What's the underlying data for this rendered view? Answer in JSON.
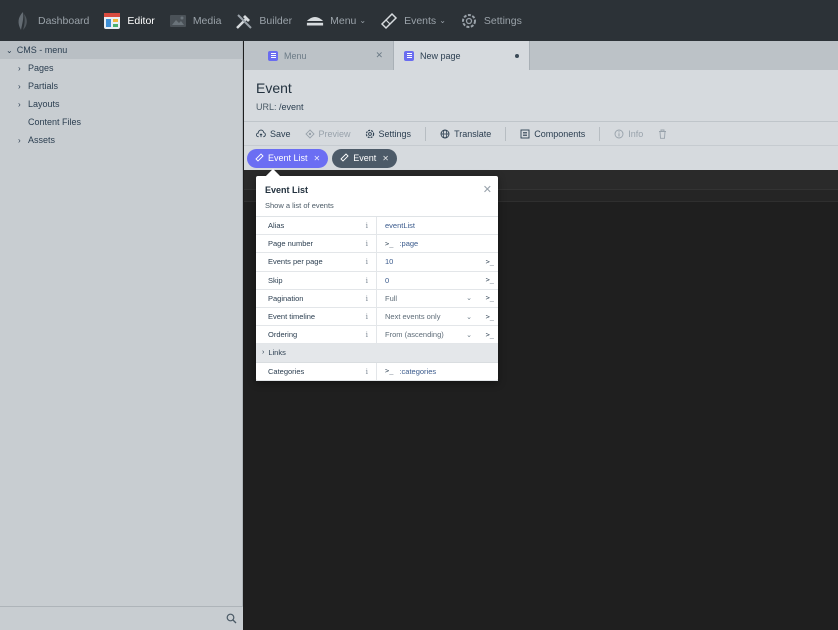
{
  "nav": {
    "items": [
      {
        "label": "Dashboard",
        "icon": "october-logo-icon",
        "active": false
      },
      {
        "label": "Editor",
        "icon": "editor-icon",
        "active": true
      },
      {
        "label": "Media",
        "icon": "media-icon",
        "active": false
      },
      {
        "label": "Builder",
        "icon": "builder-icon",
        "active": false
      },
      {
        "label": "Menu",
        "icon": "menu-icon",
        "active": false
      },
      {
        "label": "Events",
        "icon": "events-icon",
        "active": false
      },
      {
        "label": "Settings",
        "icon": "gear-icon",
        "active": false
      }
    ]
  },
  "sidebar": {
    "root": "CMS - menu",
    "items": [
      {
        "label": "Pages",
        "expandable": true
      },
      {
        "label": "Partials",
        "expandable": true
      },
      {
        "label": "Layouts",
        "expandable": true
      },
      {
        "label": "Content Files",
        "expandable": false
      },
      {
        "label": "Assets",
        "expandable": true
      }
    ]
  },
  "tabs": [
    {
      "label": "Menu",
      "active": false
    },
    {
      "label": "New page",
      "active": true
    }
  ],
  "page": {
    "title": "Event",
    "url_label": "URL:",
    "url": "/event"
  },
  "toolbar": {
    "save": "Save",
    "preview": "Preview",
    "settings": "Settings",
    "translate": "Translate",
    "components": "Components",
    "info": "Info"
  },
  "components": [
    {
      "label": "Event List",
      "active": true
    },
    {
      "label": "Event",
      "active": false
    }
  ],
  "popover": {
    "title": "Event List",
    "description": "Show a list of events",
    "props": {
      "alias": {
        "name": "Alias",
        "value": "eventList"
      },
      "page_number": {
        "name": "Page number",
        "value": ":page"
      },
      "events_per_page": {
        "name": "Events per page",
        "value": "10"
      },
      "skip": {
        "name": "Skip",
        "value": "0"
      },
      "pagination": {
        "name": "Pagination",
        "value": "Full"
      },
      "event_timeline": {
        "name": "Event timeline",
        "value": "Next events only"
      },
      "ordering": {
        "name": "Ordering",
        "value": "From (ascending)"
      },
      "links": {
        "name": "Links"
      },
      "categories": {
        "name": "Categories",
        "value": ":categories"
      }
    },
    "terminal_glyph": ">_",
    "info_glyph": "i"
  },
  "colors": {
    "nav_bg": "#2c3237",
    "accent": "#6b6ef3",
    "editor_bg": "#1f1f1f"
  }
}
